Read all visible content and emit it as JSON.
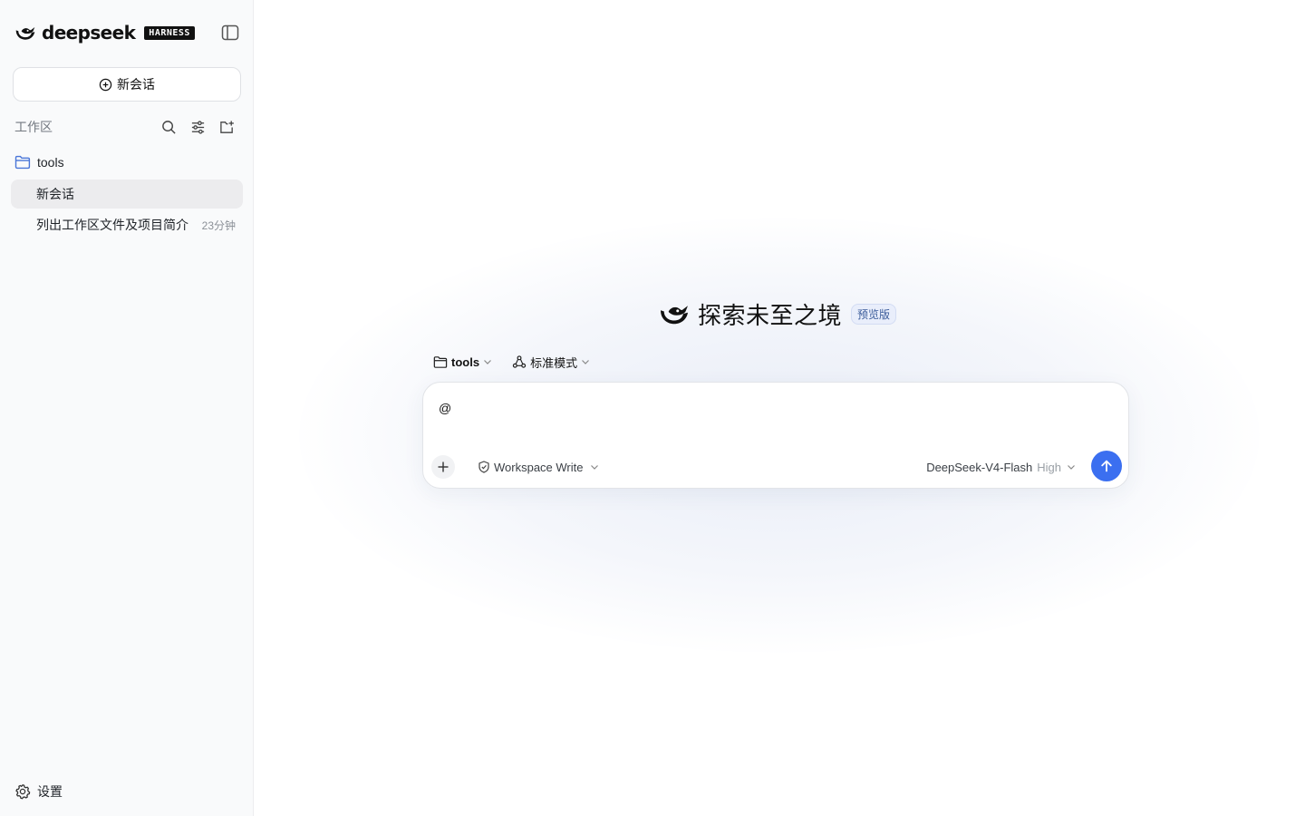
{
  "brand": {
    "name": "deepseek",
    "badge": "HARNESS"
  },
  "sidebar": {
    "new_chat_label": "新会话",
    "workspace_title": "工作区",
    "folder": {
      "name": "tools",
      "icon": "folder-icon"
    },
    "sessions": [
      {
        "title": "新会话",
        "time": "",
        "active": true
      },
      {
        "title": "列出工作区文件及项目简介",
        "time": "23分钟",
        "active": false
      }
    ],
    "settings_label": "设置"
  },
  "main": {
    "hero_title": "探索未至之境",
    "hero_badge": "预览版",
    "workspace_picker": "tools",
    "mode_picker": "标准模式",
    "composer": {
      "value": "@",
      "permission": "Workspace Write",
      "model": "DeepSeek-V4-Flash",
      "effort": "High"
    }
  },
  "colors": {
    "accent": "#3b6ff0",
    "folder": "#4a76d8",
    "sidebar_bg": "#f9fafb",
    "active_item": "#ececee",
    "badge_bg": "#e9eefb"
  }
}
